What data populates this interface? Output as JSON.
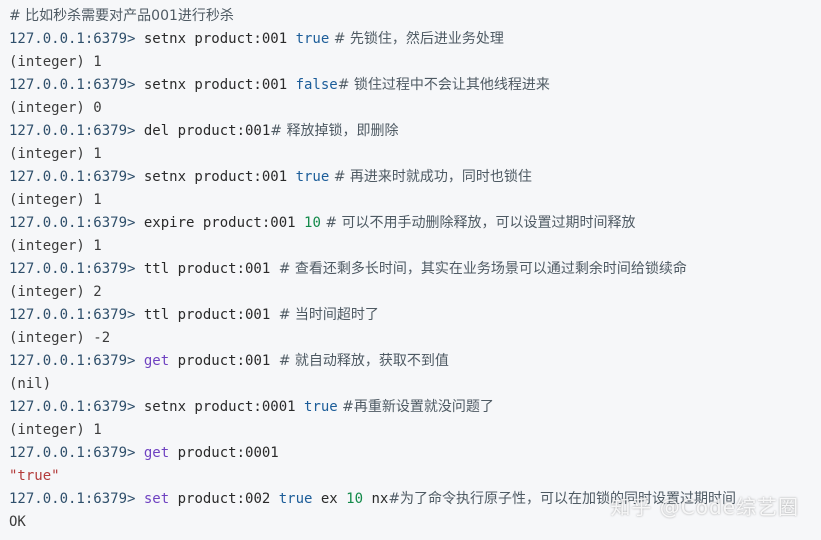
{
  "lines": [
    {
      "parts": [
        {
          "t": "# 比如秒杀需要对产品001进行秒杀",
          "c": "comment"
        }
      ]
    },
    {
      "parts": [
        {
          "t": "127.0.0.1:6379> ",
          "c": "prompt"
        },
        {
          "t": "setnx product:001 ",
          "c": "cmd"
        },
        {
          "t": "true",
          "c": "bool"
        },
        {
          "t": " # 先锁住，然后进业务处理",
          "c": "comment"
        }
      ]
    },
    {
      "parts": [
        {
          "t": "(integer) 1",
          "c": "plain"
        }
      ]
    },
    {
      "parts": [
        {
          "t": "127.0.0.1:6379> ",
          "c": "prompt"
        },
        {
          "t": "setnx product:001 ",
          "c": "cmd"
        },
        {
          "t": "false",
          "c": "bool"
        },
        {
          "t": "# 锁住过程中不会让其他线程进来",
          "c": "comment"
        }
      ]
    },
    {
      "parts": [
        {
          "t": "(integer) 0",
          "c": "plain"
        }
      ]
    },
    {
      "parts": [
        {
          "t": "127.0.0.1:6379> ",
          "c": "prompt"
        },
        {
          "t": "del product:001",
          "c": "cmd"
        },
        {
          "t": "# 释放掉锁，即删除",
          "c": "comment"
        }
      ]
    },
    {
      "parts": [
        {
          "t": "(integer) 1",
          "c": "plain"
        }
      ]
    },
    {
      "parts": [
        {
          "t": "127.0.0.1:6379> ",
          "c": "prompt"
        },
        {
          "t": "setnx product:001 ",
          "c": "cmd"
        },
        {
          "t": "true",
          "c": "bool"
        },
        {
          "t": " # 再进来时就成功，同时也锁住",
          "c": "comment"
        }
      ]
    },
    {
      "parts": [
        {
          "t": "(integer) 1",
          "c": "plain"
        }
      ]
    },
    {
      "parts": [
        {
          "t": "127.0.0.1:6379> ",
          "c": "prompt"
        },
        {
          "t": "expire product:001 ",
          "c": "cmd"
        },
        {
          "t": "10",
          "c": "num"
        },
        {
          "t": " # 可以不用手动删除释放，可以设置过期时间释放",
          "c": "comment"
        }
      ]
    },
    {
      "parts": [
        {
          "t": "(integer) 1",
          "c": "plain"
        }
      ]
    },
    {
      "parts": [
        {
          "t": "127.0.0.1:6379> ",
          "c": "prompt"
        },
        {
          "t": "ttl product:001 ",
          "c": "cmd"
        },
        {
          "t": "# 查看还剩多长时间，其实在业务场景可以通过剩余时间给锁续命",
          "c": "comment"
        }
      ]
    },
    {
      "parts": [
        {
          "t": "(integer) 2",
          "c": "plain"
        }
      ]
    },
    {
      "parts": [
        {
          "t": "127.0.0.1:6379> ",
          "c": "prompt"
        },
        {
          "t": "ttl product:001 ",
          "c": "cmd"
        },
        {
          "t": "# 当时间超时了",
          "c": "comment"
        }
      ]
    },
    {
      "parts": [
        {
          "t": "(integer) -2",
          "c": "plain"
        }
      ]
    },
    {
      "parts": [
        {
          "t": "127.0.0.1:6379> ",
          "c": "prompt"
        },
        {
          "t": "get",
          "c": "kw"
        },
        {
          "t": " product:001 ",
          "c": "cmd"
        },
        {
          "t": "# 就自动释放，获取不到值",
          "c": "comment"
        }
      ]
    },
    {
      "parts": [
        {
          "t": "(nil)",
          "c": "plain"
        }
      ]
    },
    {
      "parts": [
        {
          "t": "127.0.0.1:6379> ",
          "c": "prompt"
        },
        {
          "t": "setnx product:0001 ",
          "c": "cmd"
        },
        {
          "t": "true",
          "c": "bool"
        },
        {
          "t": " #再重新设置就没问题了",
          "c": "comment"
        }
      ]
    },
    {
      "parts": [
        {
          "t": "(integer) 1",
          "c": "plain"
        }
      ]
    },
    {
      "parts": [
        {
          "t": "127.0.0.1:6379> ",
          "c": "prompt"
        },
        {
          "t": "get",
          "c": "kw"
        },
        {
          "t": " product:0001",
          "c": "cmd"
        }
      ]
    },
    {
      "parts": [
        {
          "t": "\"true\"",
          "c": "str"
        }
      ]
    },
    {
      "parts": [
        {
          "t": "127.0.0.1:6379> ",
          "c": "prompt"
        },
        {
          "t": "set",
          "c": "kw"
        },
        {
          "t": " product:002 ",
          "c": "cmd"
        },
        {
          "t": "true",
          "c": "bool"
        },
        {
          "t": " ex ",
          "c": "cmd"
        },
        {
          "t": "10",
          "c": "num"
        },
        {
          "t": " nx",
          "c": "cmd"
        },
        {
          "t": "#为了命令执行原子性，可以在加锁的同时设置过期时间",
          "c": "comment"
        }
      ]
    },
    {
      "parts": [
        {
          "t": "OK",
          "c": "plain"
        }
      ]
    }
  ],
  "watermark": "知乎 @Code综艺圈"
}
